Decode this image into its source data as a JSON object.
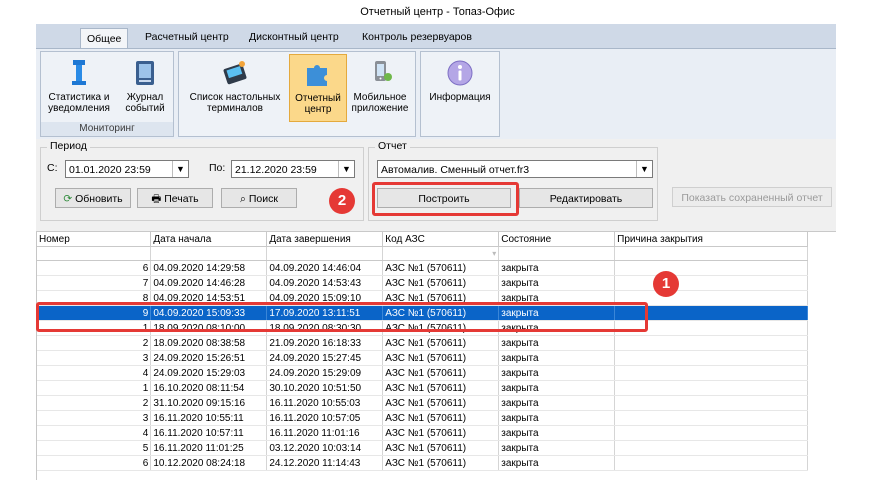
{
  "window": {
    "title": "Отчетный центр - Топаз-Офис"
  },
  "tabs": [
    {
      "label": "Общее",
      "active": true
    },
    {
      "label": "Расчетный центр",
      "active": false
    },
    {
      "label": "Дисконтный центр",
      "active": false
    },
    {
      "label": "Контроль резервуаров",
      "active": false
    }
  ],
  "ribbon": {
    "monitoring_group": "Мониторинг",
    "buttons": [
      {
        "label1": "Статистика и",
        "label2": "уведомления",
        "icon": "statistics-icon"
      },
      {
        "label1": "Журнал",
        "label2": "событий",
        "icon": "journal-icon"
      },
      {
        "label1": "Список настольных",
        "label2": "терминалов",
        "icon": "terminals-icon"
      },
      {
        "label1": "Отчетный",
        "label2": "центр",
        "icon": "puzzle-icon",
        "pressed": true
      },
      {
        "label1": "Мобильное",
        "label2": "приложение",
        "icon": "mobile-app-icon"
      },
      {
        "label1": "Информация",
        "label2": "",
        "icon": "info-icon"
      }
    ]
  },
  "period": {
    "legend": "Период",
    "from_label": "С:",
    "from_value": "01.01.2020 23:59",
    "to_label": "По:",
    "to_value": "21.12.2020 23:59",
    "refresh": "Обновить",
    "print": "Печать",
    "search": "Поиск"
  },
  "report": {
    "legend": "Отчет",
    "selected": "Автомалив. Сменный отчет.fr3",
    "build": "Построить",
    "edit": "Редактировать",
    "show_saved": "Показать сохраненный отчет"
  },
  "grid": {
    "columns": [
      "Номер",
      "Дата начала",
      "Дата завершения",
      "Код АЗС",
      "Состояние",
      "Причина закрытия"
    ],
    "rows": [
      [
        "6",
        "04.09.2020 14:29:58",
        "04.09.2020 14:46:04",
        "АЗС №1 (570611)",
        "закрыта",
        ""
      ],
      [
        "7",
        "04.09.2020 14:46:28",
        "04.09.2020 14:53:43",
        "АЗС №1 (570611)",
        "закрыта",
        ""
      ],
      [
        "8",
        "04.09.2020 14:53:51",
        "04.09.2020 15:09:10",
        "АЗС №1 (570611)",
        "закрыта",
        ""
      ],
      [
        "9",
        "04.09.2020 15:09:33",
        "17.09.2020 13:11:51",
        "АЗС №1 (570611)",
        "закрыта",
        ""
      ],
      [
        "1",
        "18.09.2020 08:10:00",
        "18.09.2020 08:30:30",
        "АЗС №1 (570611)",
        "закрыта",
        ""
      ],
      [
        "2",
        "18.09.2020 08:38:58",
        "21.09.2020 16:18:33",
        "АЗС №1 (570611)",
        "закрыта",
        ""
      ],
      [
        "3",
        "24.09.2020 15:26:51",
        "24.09.2020 15:27:45",
        "АЗС №1 (570611)",
        "закрыта",
        ""
      ],
      [
        "4",
        "24.09.2020 15:29:03",
        "24.09.2020 15:29:09",
        "АЗС №1 (570611)",
        "закрыта",
        ""
      ],
      [
        "1",
        "16.10.2020 08:11:54",
        "30.10.2020 10:51:50",
        "АЗС №1 (570611)",
        "закрыта",
        ""
      ],
      [
        "2",
        "31.10.2020 09:15:16",
        "16.11.2020 10:55:03",
        "АЗС №1 (570611)",
        "закрыта",
        ""
      ],
      [
        "3",
        "16.11.2020 10:55:11",
        "16.11.2020 10:57:05",
        "АЗС №1 (570611)",
        "закрыта",
        ""
      ],
      [
        "4",
        "16.11.2020 10:57:11",
        "16.11.2020 11:01:16",
        "АЗС №1 (570611)",
        "закрыта",
        ""
      ],
      [
        "5",
        "16.11.2020 11:01:25",
        "03.12.2020 10:03:14",
        "АЗС №1 (570611)",
        "закрыта",
        ""
      ],
      [
        "6",
        "10.12.2020 08:24:18",
        "24.12.2020 11:14:43",
        "АЗС №1 (570611)",
        "закрыта",
        ""
      ]
    ],
    "selected_row": 3
  },
  "callouts": {
    "one": "1",
    "two": "2"
  },
  "colors": {
    "selection": "#0a64c8",
    "callout": "#e53935",
    "ribbon": "#cfd9e7"
  }
}
